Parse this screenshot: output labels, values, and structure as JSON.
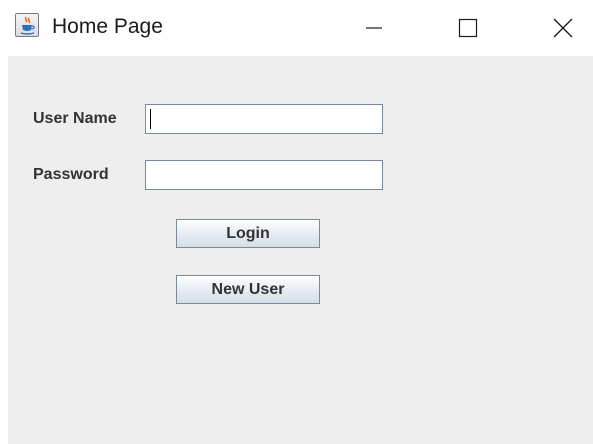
{
  "window": {
    "title": "Home Page",
    "controls": {
      "minimize": "minimize",
      "maximize": "maximize",
      "close": "close"
    }
  },
  "icons": {
    "app": "java-cup-icon",
    "minimize": "minimize-icon",
    "maximize": "maximize-icon",
    "close": "close-icon"
  },
  "form": {
    "username": {
      "label": "User Name",
      "value": "",
      "focused": true
    },
    "password": {
      "label": "Password",
      "value": ""
    },
    "login_label": "Login",
    "new_user_label": "New User"
  },
  "colors": {
    "panel_background": "#eeeeee",
    "title_background": "#ffffff",
    "label_text": "#333333",
    "field_border": "#7a8a99"
  }
}
